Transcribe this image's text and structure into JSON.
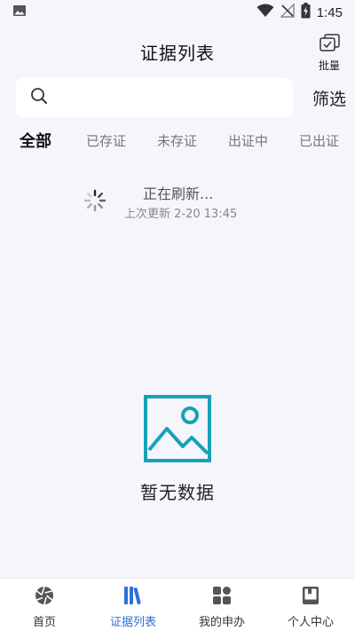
{
  "status_bar": {
    "time": "1:45",
    "icons": [
      "image-icon",
      "wifi-icon",
      "no-signal-icon",
      "battery-charging-icon"
    ]
  },
  "header": {
    "title": "证据列表",
    "batch_label": "批量",
    "batch_icon": "batch-select-icon"
  },
  "search": {
    "placeholder": "",
    "value": "",
    "icon": "search-icon",
    "filter_label": "筛选"
  },
  "tabs": [
    {
      "label": "全部",
      "active": true
    },
    {
      "label": "已存证",
      "active": false
    },
    {
      "label": "未存证",
      "active": false
    },
    {
      "label": "出证中",
      "active": false
    },
    {
      "label": "已出证",
      "active": false
    }
  ],
  "refresh": {
    "text": "正在刷新...",
    "last_update": "上次更新 2-20 13:45"
  },
  "empty": {
    "text": "暂无数据",
    "icon": "image-placeholder-icon"
  },
  "bottom_nav": [
    {
      "label": "首页",
      "icon": "aperture-icon",
      "active": false
    },
    {
      "label": "证据列表",
      "icon": "books-icon",
      "active": true
    },
    {
      "label": "我的申办",
      "icon": "grid-icon",
      "active": false
    },
    {
      "label": "个人中心",
      "icon": "bookmark-book-icon",
      "active": false
    }
  ],
  "colors": {
    "background": "#f4f6fb",
    "accent": "#2f6fd6",
    "empty_icon": "#17a2b8"
  }
}
